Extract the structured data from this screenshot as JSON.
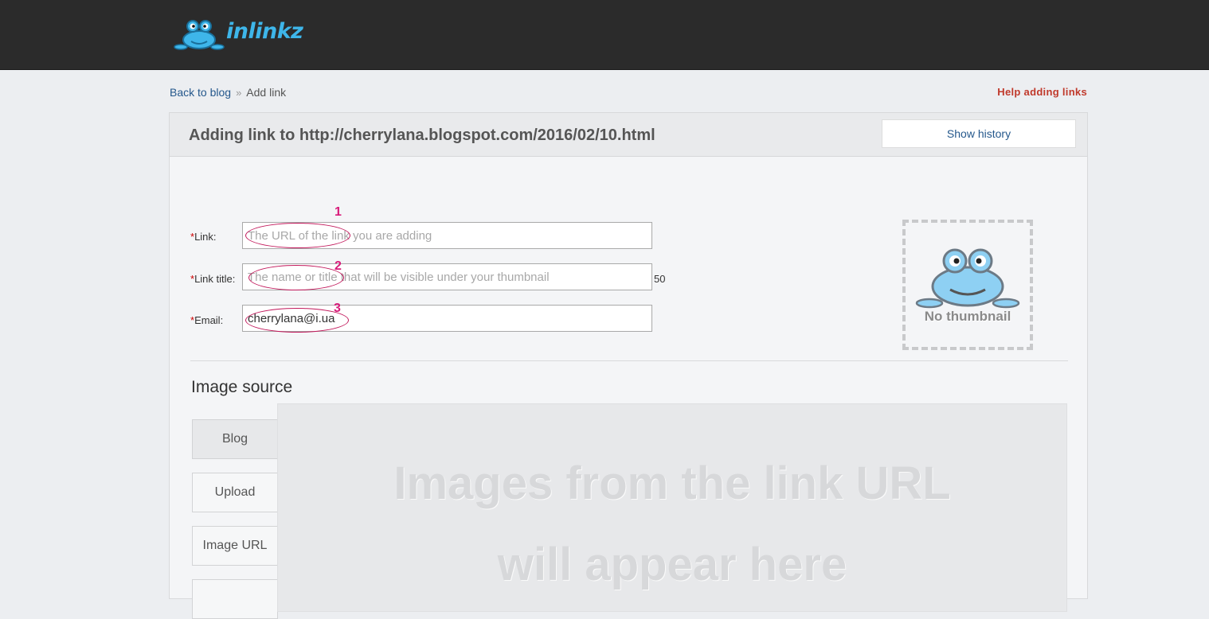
{
  "header": {
    "logo_text": "inlinkz"
  },
  "breadcrumb": {
    "back_label": "Back to blog",
    "separator": "»",
    "current": "Add link"
  },
  "help_link": "Help adding links",
  "panel": {
    "title": "Adding link to http://cherrylana.blogspot.com/2016/02/10.html",
    "show_history_label": "Show history"
  },
  "form": {
    "required_mark": "*",
    "link": {
      "label": "Link:",
      "value": "",
      "placeholder": "The URL of the link you are adding"
    },
    "title": {
      "label": "Link title:",
      "value": "",
      "placeholder": "The name or title that will be visible under your thumbnail",
      "counter": "50"
    },
    "email": {
      "label": "Email:",
      "value": "cherrylana@i.ua",
      "placeholder": ""
    }
  },
  "annotations": [
    "1",
    "2",
    "3"
  ],
  "thumbnail": {
    "placeholder_text": "No thumbnail"
  },
  "image_source": {
    "title": "Image source",
    "tabs": [
      "Blog",
      "Upload",
      "Image URL"
    ],
    "active_tab": "Blog",
    "area_line1": "Images from the link URL",
    "area_line2": "will appear here"
  },
  "colors": {
    "topbar": "#2b2b2b",
    "accent_link": "#25588c",
    "help": "#c0392b",
    "annotation": "#d81b7a"
  },
  "icons": [
    "frog-logo-icon",
    "frog-placeholder-icon",
    "breadcrumb-separator-icon"
  ]
}
